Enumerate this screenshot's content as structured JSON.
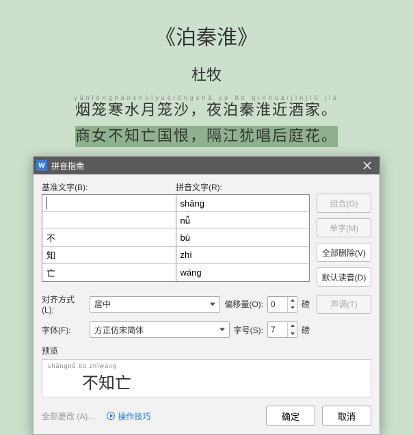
{
  "poem": {
    "title": "《泊秦淮》",
    "author": "杜牧",
    "ruby1": "yānlónghánshuǐyuèlóngshā    yè bó qínhuáijìnjiǔ jiā",
    "line1": "烟笼寒水月笼沙，夜泊秦淮近酒家。",
    "line2": "商女不知亡国恨，隔江犹唱后庭花。"
  },
  "dialog": {
    "title": "拼音指南",
    "labels": {
      "base": "基准文字(B):",
      "ruby": "拼音文字(R):",
      "align": "对齐方式(L):",
      "offset": "偏移量(O):",
      "font": "字体(F):",
      "size": "字号(S):",
      "unit": "磅",
      "preview": "预览"
    },
    "rows": [
      {
        "base": "",
        "ruby": "shāng"
      },
      {
        "base": "",
        "ruby": "nǚ"
      },
      {
        "base": "不",
        "ruby": "bù"
      },
      {
        "base": "知",
        "ruby": "zhī"
      },
      {
        "base": "亡",
        "ruby": "wáng"
      }
    ],
    "align_value": "居中",
    "offset_value": "0",
    "font_value": "方正仿宋简体",
    "size_value": "7",
    "preview": {
      "ruby": "shāngnǚ bù zhīwáng",
      "chars": "不知亡"
    },
    "buttons": {
      "combine": "组合(G)",
      "single": "单字(M)",
      "delete_all": "全部删除(V)",
      "default_reading": "默认读音(D)",
      "tone": "声调(T)",
      "change_all": "全部更改 (A)...",
      "tips": "操作技巧",
      "ok": "确定",
      "cancel": "取消"
    }
  }
}
